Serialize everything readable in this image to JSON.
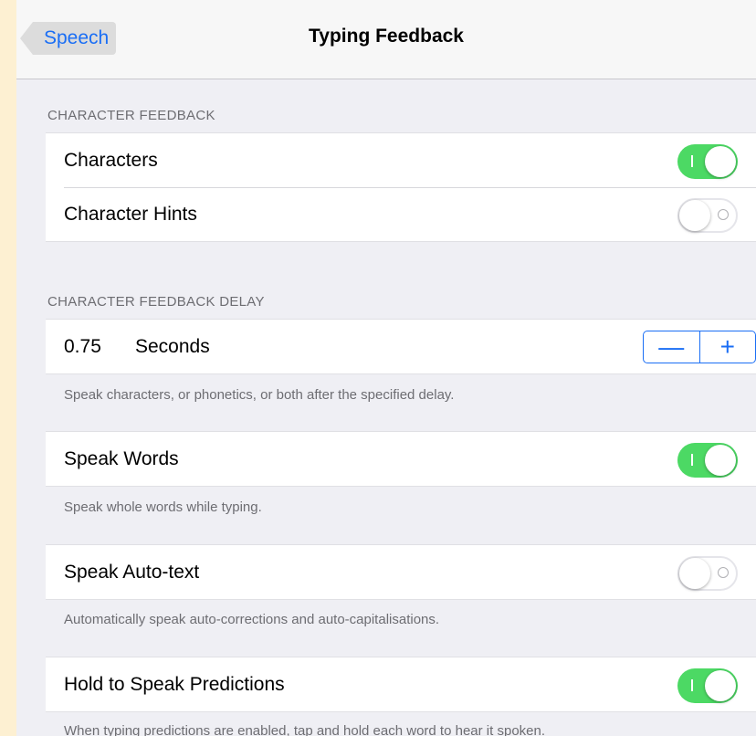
{
  "navbar": {
    "back_label": "Speech",
    "title": "Typing Feedback"
  },
  "sections": {
    "character_feedback": {
      "header": "CHARACTER FEEDBACK",
      "rows": [
        {
          "label": "Characters",
          "toggle": "on"
        },
        {
          "label": "Character Hints",
          "toggle": "off"
        }
      ]
    },
    "delay": {
      "header": "CHARACTER FEEDBACK DELAY",
      "value": "0.75",
      "unit": "Seconds",
      "minus": "—",
      "plus": "+",
      "footer": "Speak characters, or phonetics, or both after the specified delay."
    },
    "speak_words": {
      "label": "Speak Words",
      "toggle": "on",
      "footer": "Speak whole words while typing."
    },
    "speak_autotext": {
      "label": "Speak Auto-text",
      "toggle": "off",
      "footer": "Automatically speak auto-corrections and auto-capitalisations."
    },
    "hold_predictions": {
      "label": "Hold to Speak Predictions",
      "toggle": "on",
      "footer": "When typing predictions are enabled, tap and hold each word to hear it spoken."
    }
  },
  "colors": {
    "accent": "#1a6ef5",
    "toggle_on": "#4cd964",
    "background": "#efeff4"
  },
  "icons": [
    "back-chevron-icon"
  ]
}
